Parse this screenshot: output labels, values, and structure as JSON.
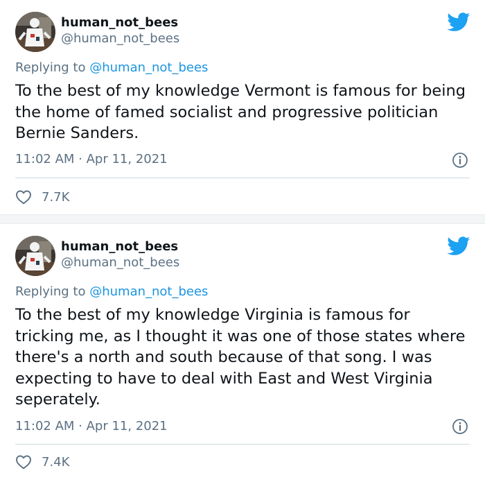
{
  "tweets": [
    {
      "display_name": "human_not_bees",
      "handle": "@human_not_bees",
      "replying_prefix": "Replying to",
      "replying_to": "@human_not_bees",
      "text": "To the best of my knowledge Vermont is famous for being the home of famed socialist and progressive politician Bernie Sanders.",
      "timestamp": "11:02 AM · Apr 11, 2021",
      "likes": "7.7K"
    },
    {
      "display_name": "human_not_bees",
      "handle": "@human_not_bees",
      "replying_prefix": "Replying to",
      "replying_to": "@human_not_bees",
      "text": "To the best of my knowledge Virginia is famous for tricking me, as I thought it was one of those states where there's a north and south because of that song. I was expecting to have to deal with East and West Virginia seperately.",
      "timestamp": "11:02 AM · Apr 11, 2021",
      "likes": "7.4K"
    }
  ],
  "icons": {
    "brand": "twitter-bird-icon",
    "info": "info-icon",
    "like": "heart-icon"
  },
  "colors": {
    "twitter_blue": "#1da1f2",
    "mention": "#1b95e0",
    "secondary_text": "#5b7083",
    "primary_text": "#0f1419"
  }
}
